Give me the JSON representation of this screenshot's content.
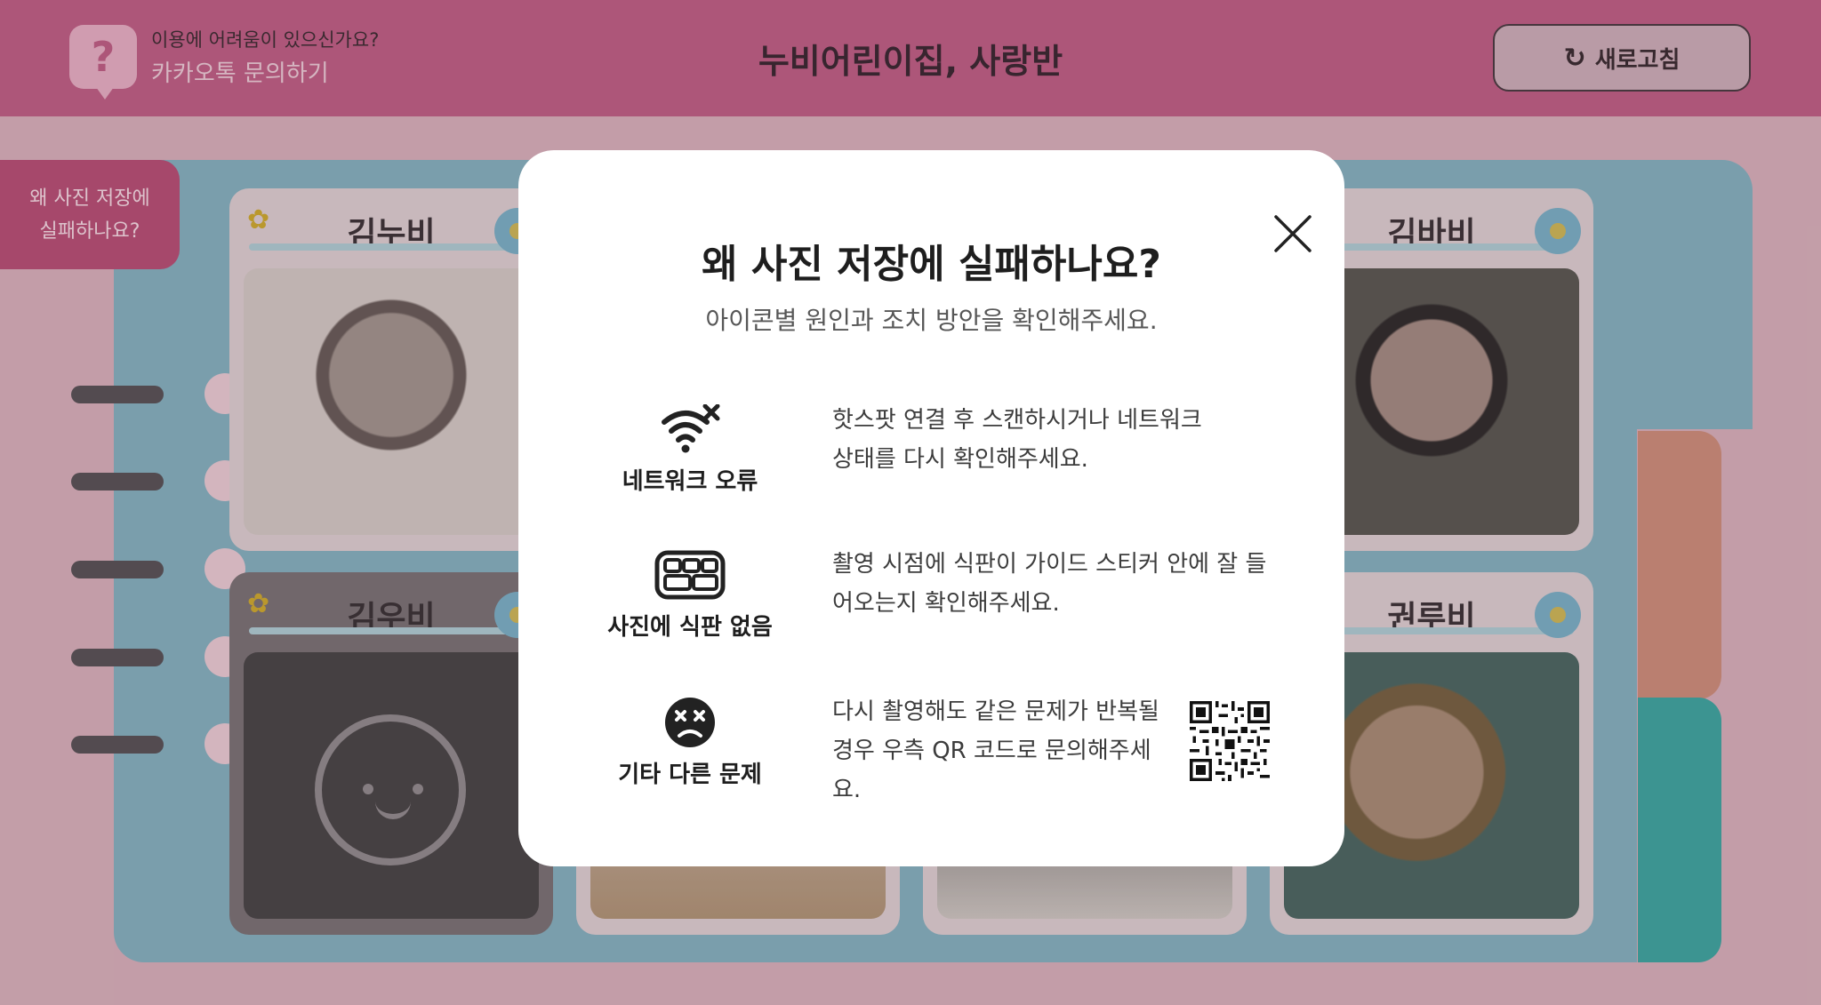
{
  "header": {
    "help_question": "이용에 어려움이 있으신가요?",
    "help_link": "카카오톡 문의하기",
    "title": "누비어린이집, 사랑반",
    "refresh_label": "새로고침"
  },
  "side_tab": {
    "line1": "왜 사진 저장에",
    "line2": "실패하나요?"
  },
  "cards": [
    {
      "name": "김누비"
    },
    {
      "name": "김바비"
    },
    {
      "name": "김우비"
    },
    {
      "name": "권루비"
    }
  ],
  "modal": {
    "title": "왜 사진 저장에 실패하나요?",
    "subtitle": "아이콘별 원인과 조치 방안을 확인해주세요.",
    "rows": [
      {
        "icon": "wifi-off-icon",
        "label": "네트워크 오류",
        "desc_line1": "핫스팟 연결 후 스캔하시거나 네트워크",
        "desc_line2": "상태를 다시 확인해주세요."
      },
      {
        "icon": "tray-icon",
        "label": "사진에 식판 없음",
        "desc_line1": "촬영 시점에 식판이 가이드 스티커 안에 잘 들",
        "desc_line2": "어오는지 확인해주세요."
      },
      {
        "icon": "sad-face-icon",
        "label": "기타 다른 문제",
        "desc_line1": "다시 촬영해도 같은 문제가 반복될",
        "desc_line2": "경우 우측 QR 코드로 문의해주세요."
      }
    ]
  }
}
